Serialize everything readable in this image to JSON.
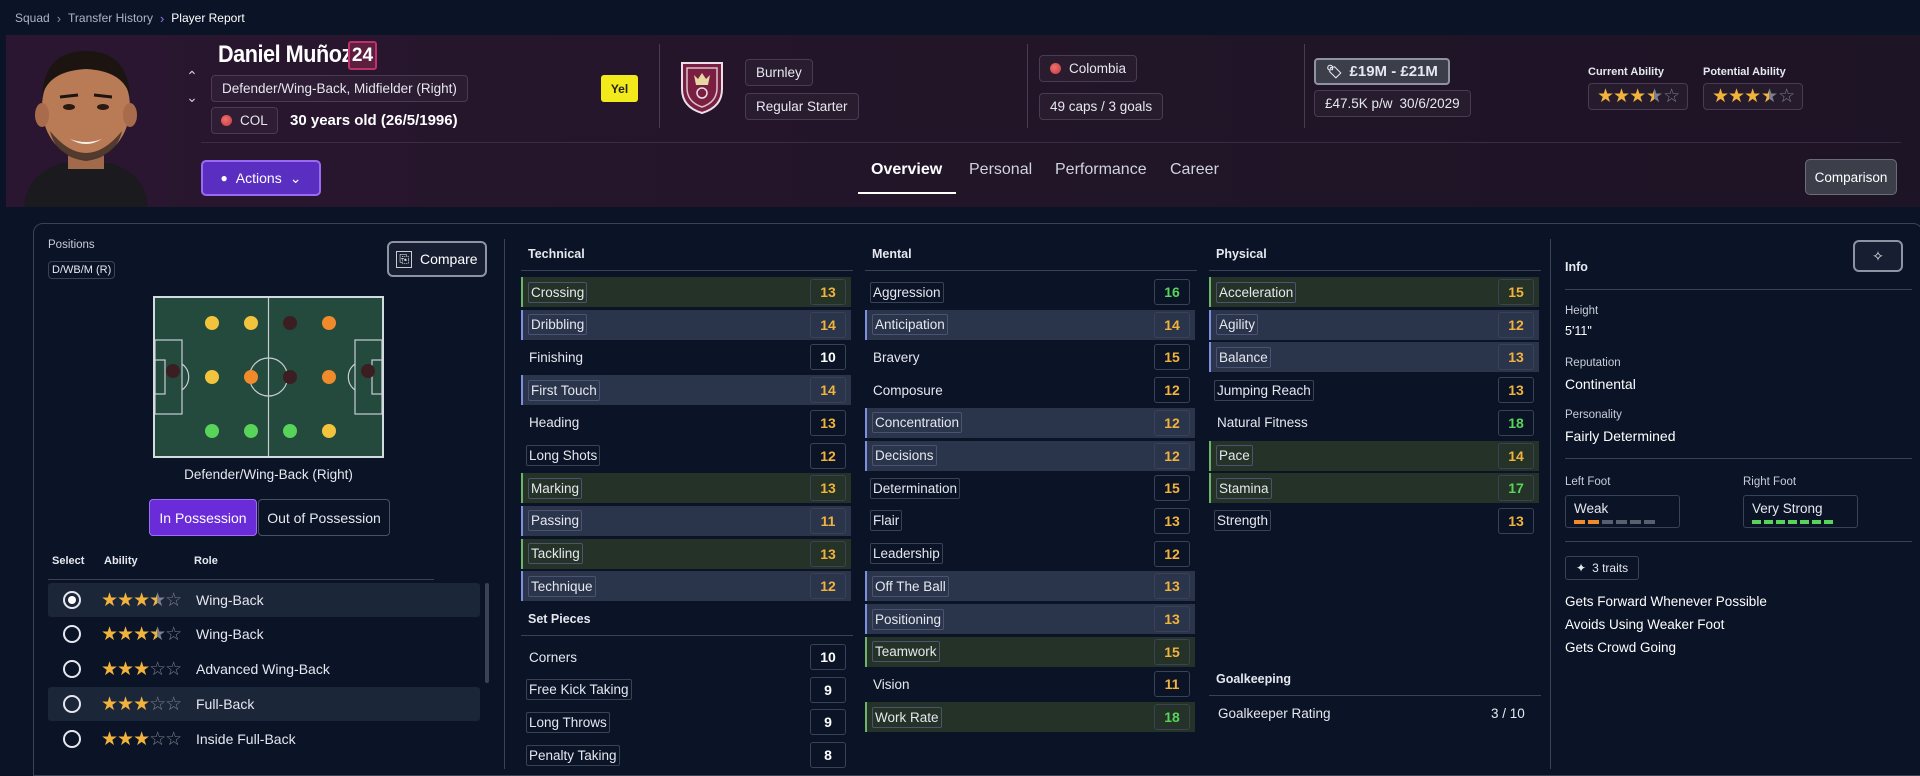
{
  "breadcrumb": [
    "Squad",
    "Transfer History",
    "Player Report"
  ],
  "player": {
    "name": "Daniel Muñoz",
    "squad_number": "24",
    "positions_text": "Defender/Wing-Back, Midfielder (Right)",
    "nation_code": "COL",
    "age_text": "30 years old (26/5/1996)",
    "card": "Yel",
    "club": "Burnley",
    "squad_status": "Regular Starter",
    "nation": "Colombia",
    "caps": "49 caps / 3 goals",
    "value": "£19M - £21M",
    "wage": "£47.5K p/w",
    "contract_end": "30/6/2029",
    "current_ability_label": "Current Ability",
    "current_ability_stars": 3.5,
    "potential_ability_label": "Potential Ability",
    "potential_ability_stars": 3.5
  },
  "actions_label": "Actions",
  "tabs": [
    "Overview",
    "Personal",
    "Performance",
    "Career"
  ],
  "active_tab": "Overview",
  "comparison_label": "Comparison",
  "positions_panel": {
    "label": "Positions",
    "chip": "D/WB/M (R)",
    "compare_label": "Compare",
    "selected_position": "Defender/Wing-Back (Right)",
    "in_possession": "In Possession",
    "out_of_possession": "Out of Possession",
    "role_headers": [
      "Select",
      "Ability",
      "Role"
    ],
    "roles": [
      {
        "name": "Wing-Back",
        "stars": 3.5,
        "selected": true
      },
      {
        "name": "Wing-Back",
        "stars": 3.5,
        "selected": false
      },
      {
        "name": "Advanced Wing-Back",
        "stars": 3,
        "selected": false
      },
      {
        "name": "Full-Back",
        "stars": 3,
        "selected": false
      },
      {
        "name": "Inside Full-Back",
        "stars": 3,
        "selected": false
      }
    ]
  },
  "technical": {
    "title": "Technical",
    "items": [
      {
        "name": "Crossing",
        "value": 13,
        "hl": "hg"
      },
      {
        "name": "Dribbling",
        "value": 14,
        "hl": "hl"
      },
      {
        "name": "Finishing",
        "value": 10,
        "hl": ""
      },
      {
        "name": "First Touch",
        "value": 14,
        "hl": "hl"
      },
      {
        "name": "Heading",
        "value": 13,
        "hl": ""
      },
      {
        "name": "Long Shots",
        "value": 12,
        "hl": "nohl"
      },
      {
        "name": "Marking",
        "value": 13,
        "hl": "hg"
      },
      {
        "name": "Passing",
        "value": 11,
        "hl": "hl"
      },
      {
        "name": "Tackling",
        "value": 13,
        "hl": "hg"
      },
      {
        "name": "Technique",
        "value": 12,
        "hl": "hl"
      }
    ]
  },
  "set_pieces": {
    "title": "Set Pieces",
    "items": [
      {
        "name": "Corners",
        "value": 10,
        "hl": ""
      },
      {
        "name": "Free Kick Taking",
        "value": 9,
        "hl": "nohl"
      },
      {
        "name": "Long Throws",
        "value": 9,
        "hl": "nohl"
      },
      {
        "name": "Penalty Taking",
        "value": 8,
        "hl": "nohl"
      }
    ]
  },
  "mental": {
    "title": "Mental",
    "items": [
      {
        "name": "Aggression",
        "value": 16,
        "hl": "nohl"
      },
      {
        "name": "Anticipation",
        "value": 14,
        "hl": "hl"
      },
      {
        "name": "Bravery",
        "value": 15,
        "hl": ""
      },
      {
        "name": "Composure",
        "value": 12,
        "hl": ""
      },
      {
        "name": "Concentration",
        "value": 12,
        "hl": "hl"
      },
      {
        "name": "Decisions",
        "value": 12,
        "hl": "hl"
      },
      {
        "name": "Determination",
        "value": 15,
        "hl": "nohl"
      },
      {
        "name": "Flair",
        "value": 13,
        "hl": "nohl"
      },
      {
        "name": "Leadership",
        "value": 12,
        "hl": "nohl"
      },
      {
        "name": "Off The Ball",
        "value": 13,
        "hl": "hl"
      },
      {
        "name": "Positioning",
        "value": 13,
        "hl": "hl"
      },
      {
        "name": "Teamwork",
        "value": 15,
        "hl": "hg"
      },
      {
        "name": "Vision",
        "value": 11,
        "hl": ""
      },
      {
        "name": "Work Rate",
        "value": 18,
        "hl": "hg"
      }
    ]
  },
  "physical": {
    "title": "Physical",
    "items": [
      {
        "name": "Acceleration",
        "value": 15,
        "hl": "hg"
      },
      {
        "name": "Agility",
        "value": 12,
        "hl": "hl"
      },
      {
        "name": "Balance",
        "value": 13,
        "hl": "hl"
      },
      {
        "name": "Jumping Reach",
        "value": 13,
        "hl": "nohl"
      },
      {
        "name": "Natural Fitness",
        "value": 18,
        "hl": ""
      },
      {
        "name": "Pace",
        "value": 14,
        "hl": "hg"
      },
      {
        "name": "Stamina",
        "value": 17,
        "hl": "hg"
      },
      {
        "name": "Strength",
        "value": 13,
        "hl": "nohl"
      }
    ]
  },
  "goalkeeping": {
    "title": "Goalkeeping",
    "rating_label": "Goalkeeper Rating",
    "rating_value": "3 / 10"
  },
  "info": {
    "title": "Info",
    "height_label": "Height",
    "height": "5'11\"",
    "reputation_label": "Reputation",
    "reputation": "Continental",
    "personality_label": "Personality",
    "personality": "Fairly Determined",
    "left_foot_label": "Left Foot",
    "left_foot": "Weak",
    "left_foot_level": 2,
    "right_foot_label": "Right Foot",
    "right_foot": "Very Strong",
    "right_foot_level": 7,
    "traits_label": "3 traits",
    "traits": [
      "Gets Forward Whenever Possible",
      "Avoids Using Weaker Foot",
      "Gets Crowd Going"
    ]
  },
  "colors": {
    "accent": "#6a2bd9",
    "good": "#58d45a",
    "mid": "#f2b33d",
    "card_yellow": "#f3ea1b"
  }
}
